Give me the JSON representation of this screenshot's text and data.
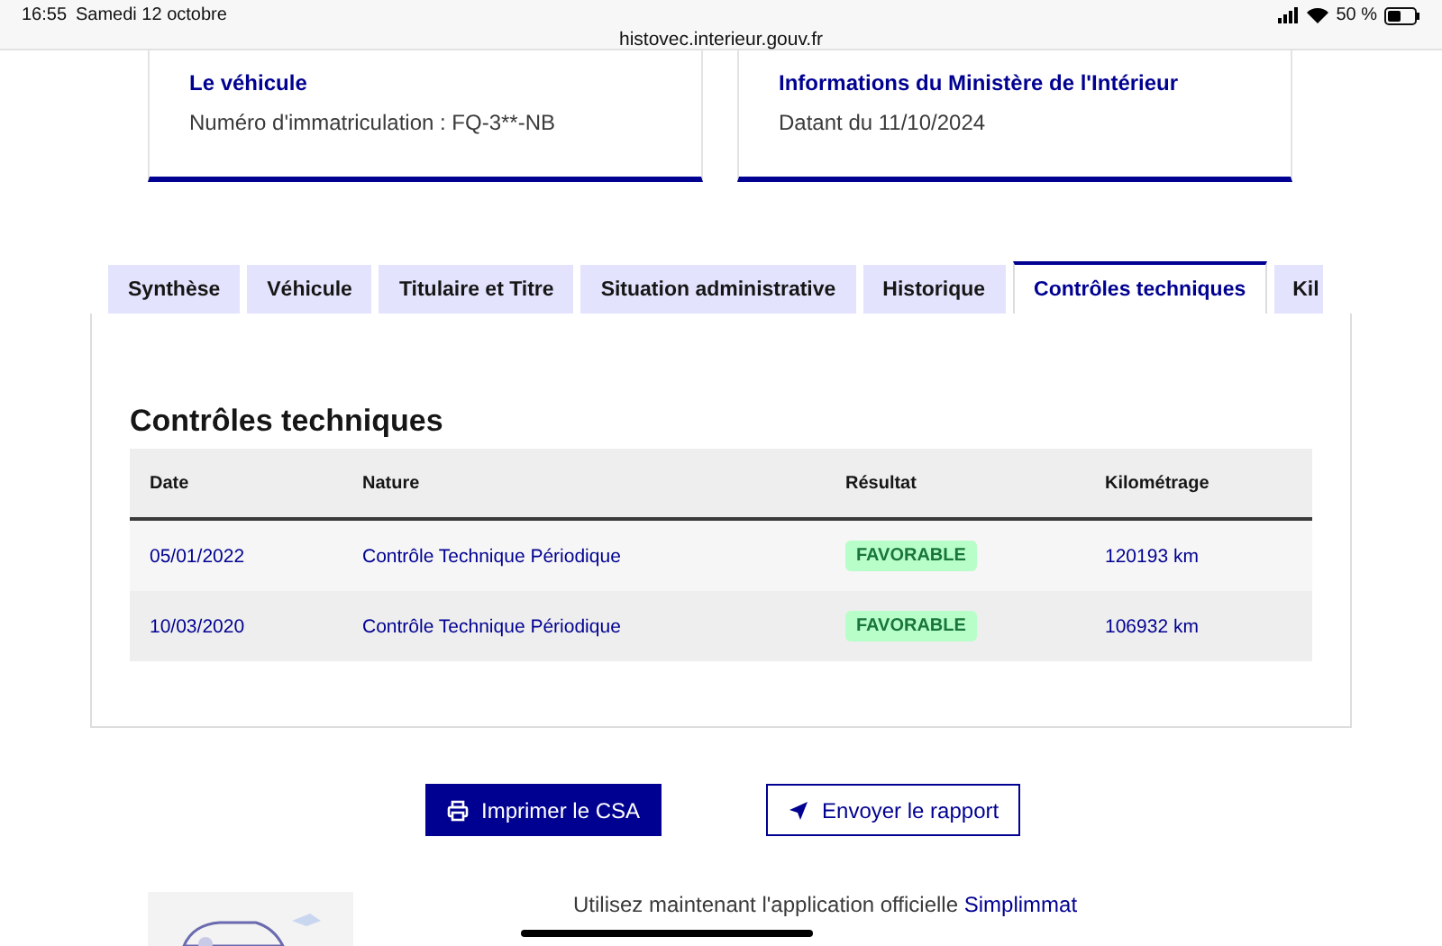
{
  "status_bar": {
    "time": "16:55",
    "date": "Samedi 12 octobre",
    "url": "histovec.interieur.gouv.fr",
    "battery": "50 %"
  },
  "cards": [
    {
      "title": "Le véhicule",
      "text": "Numéro d'immatriculation : FQ-3**-NB"
    },
    {
      "title": "Informations du Ministère de l'Intérieur",
      "text": "Datant du 11/10/2024"
    }
  ],
  "tabs": [
    {
      "label": "Synthèse",
      "selected": false
    },
    {
      "label": "Véhicule",
      "selected": false
    },
    {
      "label": "Titulaire et Titre",
      "selected": false
    },
    {
      "label": "Situation administrative",
      "selected": false
    },
    {
      "label": "Historique",
      "selected": false
    },
    {
      "label": "Contrôles techniques",
      "selected": true
    },
    {
      "label": "Kil",
      "selected": false
    }
  ],
  "section_title": "Contrôles techniques",
  "table": {
    "columns": [
      "Date",
      "Nature",
      "Résultat",
      "Kilométrage"
    ],
    "rows": [
      {
        "date": "05/01/2022",
        "nature": "Contrôle Technique Périodique",
        "result": "FAVORABLE",
        "km": "120193 km"
      },
      {
        "date": "10/03/2020",
        "nature": "Contrôle Technique Périodique",
        "result": "FAVORABLE",
        "km": "106932 km"
      }
    ]
  },
  "buttons": [
    {
      "label": "Imprimer le CSA",
      "kind": "primary"
    },
    {
      "label": "Envoyer le rapport",
      "kind": "secondary"
    }
  ],
  "footer": {
    "text": "Utilisez maintenant l'application officielle",
    "link": "Simplimmat"
  }
}
